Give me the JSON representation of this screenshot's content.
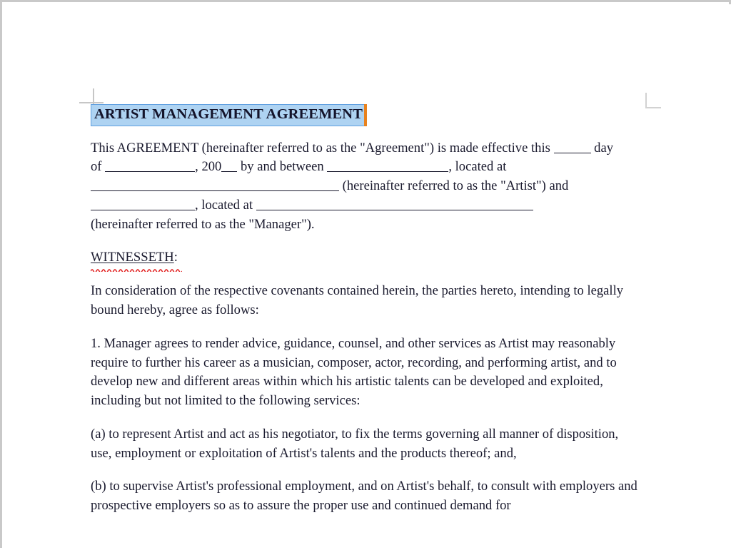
{
  "document": {
    "title": "ARTIST MANAGEMENT AGREEMENT",
    "title_selected": true,
    "selection_fill": "#aed3f2",
    "selection_border": "#5f9fe0",
    "caret_color": "#e8821e",
    "page_background": "#ffffff",
    "text_color": "#1a1a2e",
    "spellcheck_color": "#e01b1b",
    "margin_guide_color": "#c6c6c6"
  },
  "body": {
    "p1_seg1": "This AGREEMENT (hereinafter referred to as the \"Agreement\") is made effective this ",
    "p1_seg2": " day of ",
    "p1_seg3": ", 200",
    "p1_seg4": " by and between ",
    "p1_seg5": ", located at ",
    "p1_seg6": " (hereinafter referred to as the \"Artist\") and ",
    "p1_seg7": ", located at ",
    "p1_seg8": "(hereinafter referred to as the \"Manager\").",
    "witnesseth_word": "WITNESSETH",
    "witnesseth_colon": ":",
    "p2": "In consideration of the respective covenants contained herein, the parties hereto, intending to legally bound hereby, agree as follows:",
    "p3": "1. Manager agrees to render advice, guidance, counsel, and other services as Artist may reasonably require to further his career as a musician, composer, actor, recording, and performing artist, and to develop new and different areas within which his artistic talents can be developed and exploited, including but not limited to the following services:",
    "p4": "(a) to represent Artist and act as his negotiator, to fix the terms governing all manner of disposition, use, employment or exploitation of Artist's talents and the products thereof; and,",
    "p5": "(b) to supervise Artist's professional employment, and on Artist's behalf, to consult with employers and prospective employers so as to assure the proper use and continued demand for"
  }
}
